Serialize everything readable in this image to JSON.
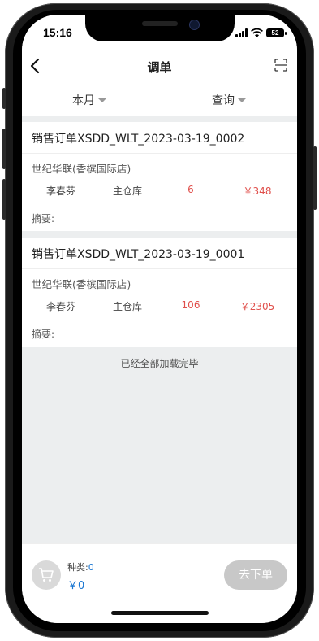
{
  "status_bar": {
    "time": "15:16",
    "battery": "52"
  },
  "nav": {
    "title": "调单"
  },
  "filters": {
    "period": "本月",
    "query": "查询"
  },
  "orders": [
    {
      "title": "销售订单XSDD_WLT_2023-03-19_0002",
      "store": "世纪华联(香槟国际店)",
      "person": "李春芬",
      "warehouse": "主仓库",
      "quantity": "6",
      "amount": "￥348",
      "summary_label": "摘要:"
    },
    {
      "title": "销售订单XSDD_WLT_2023-03-19_0001",
      "store": "世纪华联(香槟国际店)",
      "person": "李春芬",
      "warehouse": "主仓库",
      "quantity": "106",
      "amount": "￥2305",
      "summary_label": "摘要:"
    }
  ],
  "list_end_text": "已经全部加载完毕",
  "footer": {
    "kinds_label": "种类:",
    "kinds_value": "0",
    "total": "￥0",
    "submit_label": "去下单"
  },
  "colors": {
    "accent": "#1976d2",
    "price_red": "#e0514d",
    "disabled_button": "#c8c8c8"
  }
}
